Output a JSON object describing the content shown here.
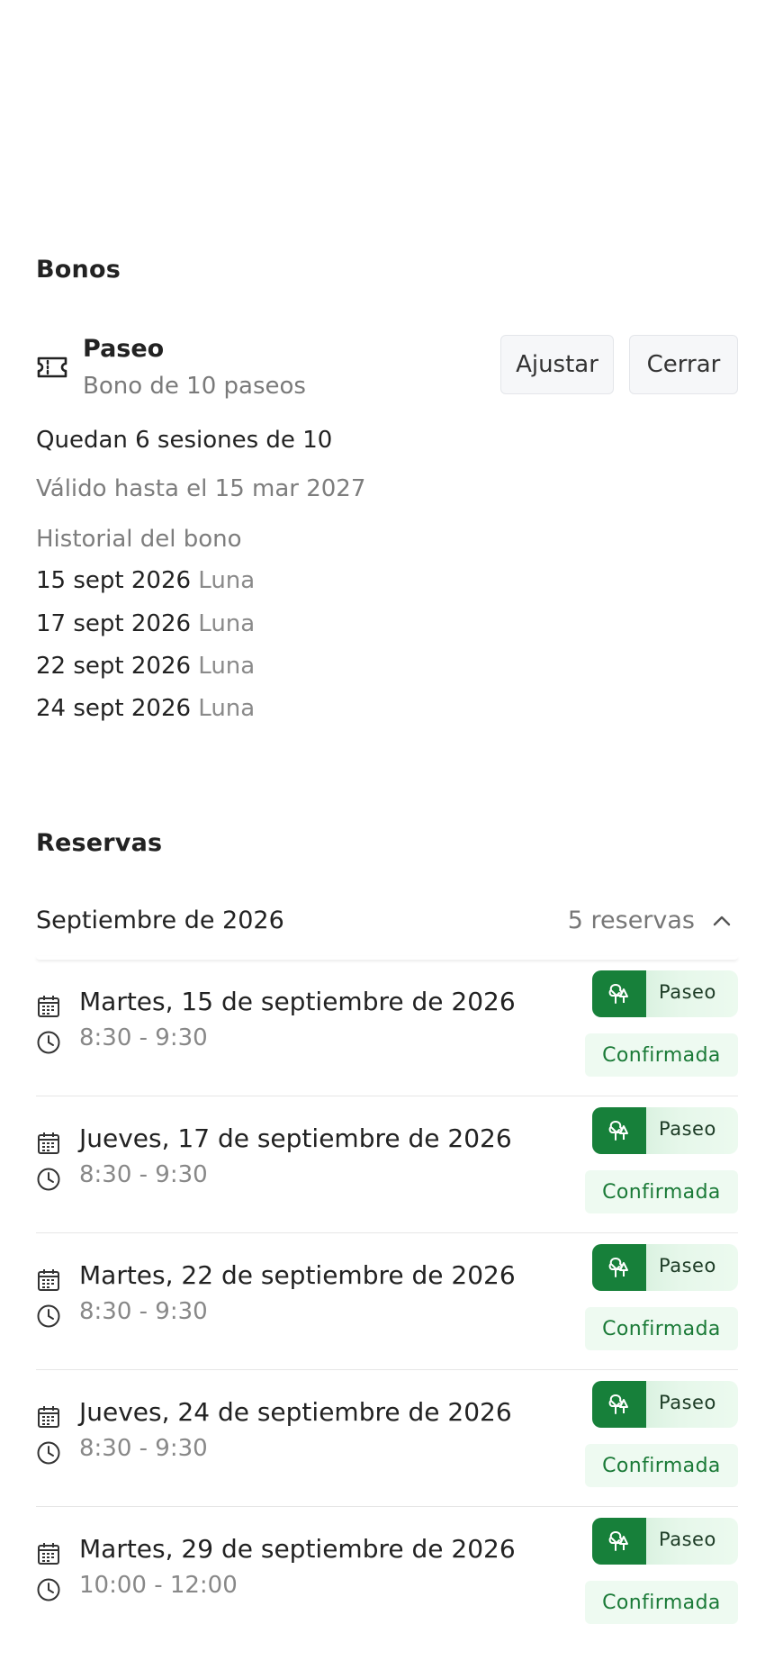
{
  "bonos": {
    "title": "Bonos",
    "item": {
      "name": "Paseo",
      "description": "Bono de 10 paseos",
      "adjust_label": "Ajustar",
      "close_label": "Cerrar",
      "remaining": "Quedan 6 sesiones de 10",
      "valid_until": "Válido hasta el 15 mar 2027",
      "history_title": "Historial del bono",
      "history": [
        {
          "date": "15 sept 2026",
          "name": "Luna"
        },
        {
          "date": "17 sept 2026",
          "name": "Luna"
        },
        {
          "date": "22 sept 2026",
          "name": "Luna"
        },
        {
          "date": "24 sept 2026",
          "name": "Luna"
        }
      ]
    }
  },
  "reservas": {
    "title": "Reservas",
    "month": {
      "label": "Septiembre de 2026",
      "count": "5 reservas",
      "icon": "chevron-up-icon"
    },
    "items": [
      {
        "date": "Martes, 15 de septiembre de 2026",
        "time": "8:30 - 9:30",
        "service": "Paseo",
        "status": "Confirmada"
      },
      {
        "date": "Jueves, 17 de septiembre de 2026",
        "time": "8:30 - 9:30",
        "service": "Paseo",
        "status": "Confirmada"
      },
      {
        "date": "Martes, 22 de septiembre de 2026",
        "time": "8:30 - 9:30",
        "service": "Paseo",
        "status": "Confirmada"
      },
      {
        "date": "Jueves, 24 de septiembre de 2026",
        "time": "8:30 - 9:30",
        "service": "Paseo",
        "status": "Confirmada"
      },
      {
        "date": "Martes, 29 de septiembre de 2026",
        "time": "10:00 - 12:00",
        "service": "Paseo",
        "status": "Confirmada"
      }
    ]
  },
  "colors": {
    "accent_green": "#17803a",
    "status_green_text": "#1a7a37",
    "status_green_bg": "#eefaf1"
  }
}
